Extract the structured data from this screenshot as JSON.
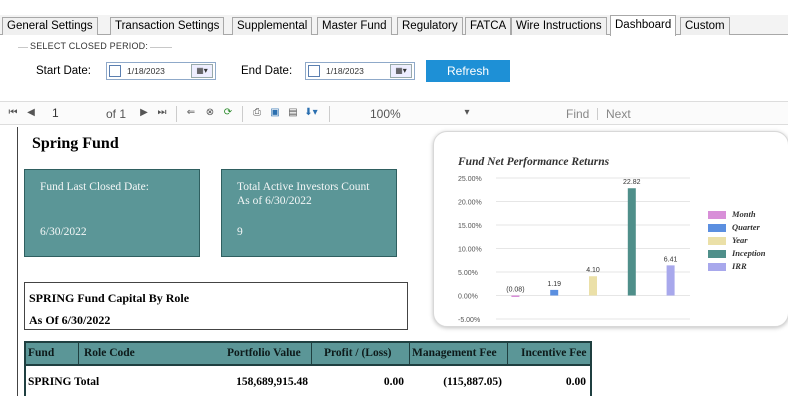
{
  "tabs": [
    {
      "label": "General Settings",
      "active": false
    },
    {
      "label": "Transaction Settings",
      "active": false
    },
    {
      "label": "Supplemental",
      "active": false
    },
    {
      "label": "Master Fund",
      "active": false
    },
    {
      "label": "Regulatory",
      "active": false
    },
    {
      "label": "FATCA",
      "active": false
    },
    {
      "label": "Wire Instructions",
      "active": false
    },
    {
      "label": "Dashboard",
      "active": true
    },
    {
      "label": "Custom",
      "active": false
    }
  ],
  "period": {
    "legend": "SELECT CLOSED PERIOD:",
    "start_label": "Start Date:",
    "start_value": "1/18/2023",
    "end_label": "End Date:",
    "end_value": "1/18/2023",
    "refresh_label": "Refresh"
  },
  "report_toolbar": {
    "page_current": "1",
    "page_of": "of 1",
    "zoom": "100%",
    "find_label": "Find",
    "next_label": "Next"
  },
  "report": {
    "fund_name": "Spring Fund",
    "card1": {
      "title": "Fund Last Closed Date:",
      "value": "6/30/2022"
    },
    "card2": {
      "title": "Total Active Investors Count",
      "subtitle": "As of 6/30/2022",
      "value": "9"
    },
    "capital": {
      "title": "SPRING Fund Capital By Role",
      "subtitle": "As Of 6/30/2022"
    },
    "table": {
      "columns": [
        "Fund",
        "Role Code",
        "Portfolio Value",
        "Profit / (Loss)",
        "Management Fee",
        "Incentive Fee"
      ],
      "rows": [
        {
          "fund": "SPRING Total",
          "role_code": "",
          "portfolio_value": "158,689,915.48",
          "profit_loss": "0.00",
          "management_fee": "(115,887.05)",
          "incentive_fee": "0.00"
        }
      ]
    }
  },
  "chart_data": {
    "type": "bar",
    "title": "Fund Net Performance Returns",
    "y_ticks": [
      "25.00%",
      "20.00%",
      "15.00%",
      "10.00%",
      "5.00%",
      "0.00%",
      "-5.00%"
    ],
    "ylim": [
      -5,
      25
    ],
    "series": [
      {
        "name": "Month",
        "value": -0.08,
        "label": "(0.08)",
        "color": "#d88fd8"
      },
      {
        "name": "Quarter",
        "value": 1.19,
        "label": "1.19",
        "color": "#5b8fe0"
      },
      {
        "name": "Year",
        "value": 4.1,
        "label": "4.10",
        "color": "#ebe0a8"
      },
      {
        "name": "Inception",
        "value": 22.82,
        "label": "22.82",
        "color": "#4f8f8a"
      },
      {
        "name": "IRR",
        "value": 6.41,
        "label": "6.41",
        "color": "#a8a8ec"
      }
    ]
  }
}
